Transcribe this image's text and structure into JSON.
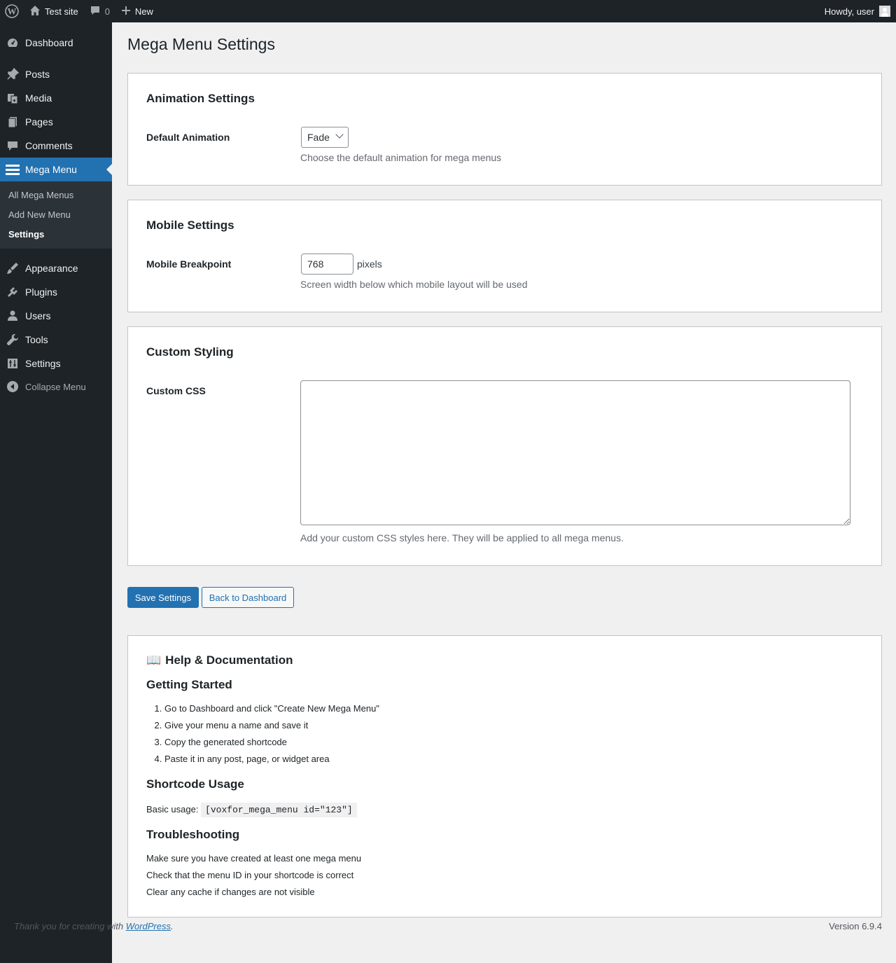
{
  "adminbar": {
    "site_name": "Test site",
    "comment_count": "0",
    "new_label": "New",
    "greeting": "Howdy, user"
  },
  "sidebar": {
    "items": [
      {
        "label": "Dashboard",
        "icon": "dashboard-icon"
      },
      {
        "label": "Posts",
        "icon": "pushpin-icon"
      },
      {
        "label": "Media",
        "icon": "media-icon"
      },
      {
        "label": "Pages",
        "icon": "pages-icon"
      },
      {
        "label": "Comments",
        "icon": "comment-icon"
      },
      {
        "label": "Mega Menu",
        "icon": "menu-icon"
      },
      {
        "label": "Appearance",
        "icon": "brush-icon"
      },
      {
        "label": "Plugins",
        "icon": "plugin-icon"
      },
      {
        "label": "Users",
        "icon": "user-icon"
      },
      {
        "label": "Tools",
        "icon": "wrench-icon"
      },
      {
        "label": "Settings",
        "icon": "settings-icon"
      }
    ],
    "submenu": [
      "All Mega Menus",
      "Add New Menu",
      "Settings"
    ],
    "collapse_label": "Collapse Menu"
  },
  "page": {
    "title": "Mega Menu Settings"
  },
  "animation": {
    "heading": "Animation Settings",
    "label": "Default Animation",
    "selected": "Fade",
    "description": "Choose the default animation for mega menus"
  },
  "mobile": {
    "heading": "Mobile Settings",
    "label": "Mobile Breakpoint",
    "value": "768",
    "unit": "pixels",
    "description": "Screen width below which mobile layout will be used"
  },
  "styling": {
    "heading": "Custom Styling",
    "label": "Custom CSS",
    "value": "",
    "description": "Add your custom CSS styles here. They will be applied to all mega menus."
  },
  "actions": {
    "save": "Save Settings",
    "back": "Back to Dashboard"
  },
  "help": {
    "title": "Help & Documentation",
    "book_emoji": "📖",
    "getting_started": "Getting Started",
    "steps": [
      "Go to Dashboard and click \"Create New Mega Menu\"",
      "Give your menu a name and save it",
      "Copy the generated shortcode",
      "Paste it in any post, page, or widget area"
    ],
    "shortcode_heading": "Shortcode Usage",
    "basic_usage_label": "Basic usage:",
    "shortcode": "[voxfor_mega_menu id=\"123\"]",
    "troubleshooting_heading": "Troubleshooting",
    "tips": [
      "Make sure you have created at least one mega menu",
      "Check that the menu ID in your shortcode is correct",
      "Clear any cache if changes are not visible"
    ]
  },
  "footer": {
    "thanks_prefix": "Thank you for creating with",
    "wp_link": "WordPress",
    "thanks_suffix": ".",
    "version": "Version 6.9.4"
  },
  "colors": {
    "accent": "#2271b1",
    "sidebar_bg": "#1d2327",
    "page_bg": "#f0f0f1"
  }
}
